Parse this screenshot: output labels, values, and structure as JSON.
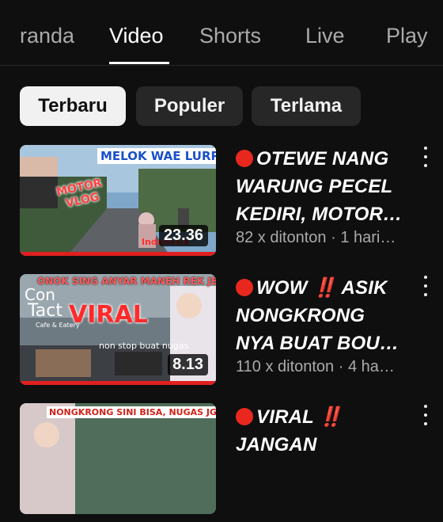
{
  "tabs": [
    {
      "label": "randa",
      "active": false
    },
    {
      "label": "Video",
      "active": true
    },
    {
      "label": "Shorts",
      "active": false
    },
    {
      "label": "Live",
      "active": false
    },
    {
      "label": "Play",
      "active": false
    }
  ],
  "chips": [
    {
      "label": "Terbaru",
      "selected": true
    },
    {
      "label": "Populer",
      "selected": false
    },
    {
      "label": "Terlama",
      "selected": false
    }
  ],
  "videos": [
    {
      "title_lines": [
        "OTEWE NANG",
        "WARUNG PECEL",
        "KEDIRI, MOTOR…"
      ],
      "title_prefix": "live-dot",
      "views": "82 x ditonton",
      "separator": "·",
      "age": "1 hari…",
      "duration": "23.36",
      "thumb_texts": [
        "MELOK WAE LURR",
        "MOTOR",
        "VLOG",
        "Indonesia"
      ]
    },
    {
      "title_lines": [
        "WOW ‼️ ASIK",
        "NONGKRONG",
        "NYA BUAT BOU…"
      ],
      "title_prefix": "live-dot",
      "views": "110 x ditonton",
      "separator": "·",
      "age": "4 ha…",
      "duration": "8.13",
      "thumb_texts": [
        "ONOK SING ANYAR MANEH REK JEMBER",
        "Con",
        "Tact",
        "Cafe & Eatery",
        "VIRAL",
        "non stop buat nugas"
      ]
    },
    {
      "title_lines": [
        "VIRAL ‼️",
        "JANGAN"
      ],
      "title_prefix": "live-dot",
      "thumb_texts": [
        "NONGKRONG SINI BISA, NUGAS JG BISA"
      ]
    }
  ],
  "colors": {
    "background": "#0f0f0f",
    "accent_red": "#e8281e",
    "chip_bg": "#272727",
    "chip_selected_bg": "#f1f1f1",
    "meta_text": "#aaaaaa"
  },
  "icons": {
    "more": "more-vert-icon",
    "live": "red-circle-icon"
  }
}
